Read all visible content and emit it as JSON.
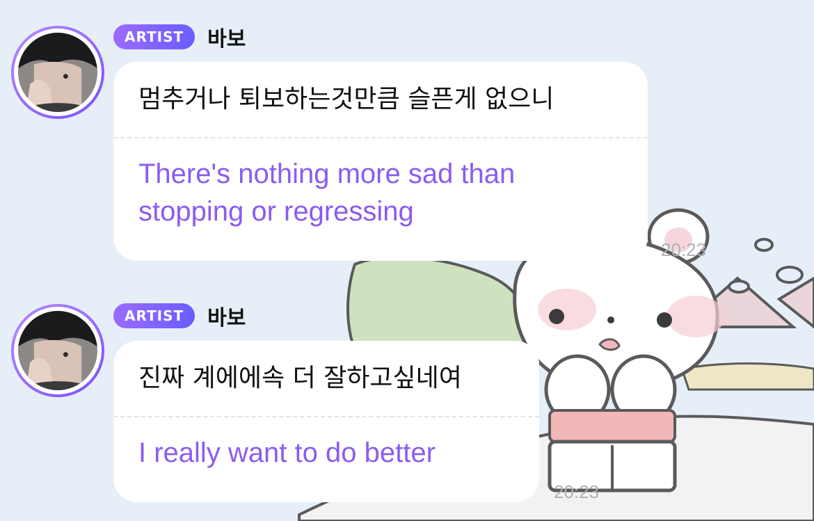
{
  "messages": [
    {
      "badge": "ARTIST",
      "sender": "바보",
      "text_ko": "멈추거나 퇴보하는것만큼 슬픈게 없으니",
      "text_en": "There's nothing more sad than stopping or regressing",
      "time": "20:23"
    },
    {
      "badge": "ARTIST",
      "sender": "바보",
      "text_ko": "진짜 계에에속 더 잘하고싶네여",
      "text_en": "I really want to do better",
      "time": "20:23"
    }
  ],
  "colors": {
    "background": "#e6eff8",
    "badge": "#8a5cf0",
    "translation_text": "#8a5cf0",
    "bubble": "#ffffff",
    "time": "#b0b0b8"
  },
  "icons": {
    "avatar": "artist-avatar-photo",
    "background": "bear-illustration"
  }
}
